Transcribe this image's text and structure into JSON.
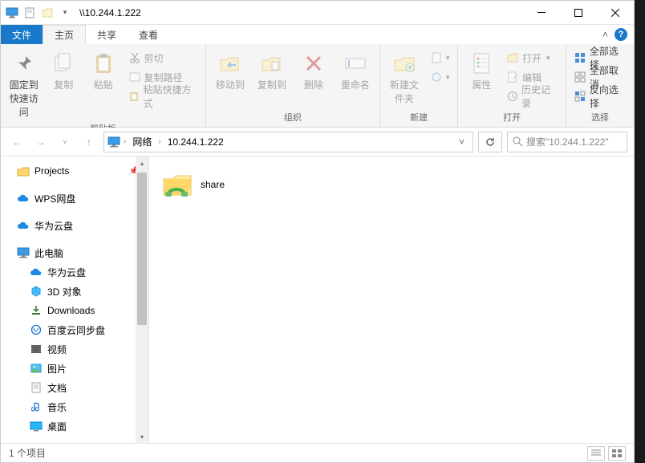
{
  "title": "\\\\10.244.1.222",
  "tabs": {
    "file": "文件",
    "home": "主页",
    "share": "共享",
    "view": "查看"
  },
  "ribbon": {
    "clipboard": {
      "label": "剪贴板",
      "pin": "固定到快速访问",
      "copy": "复制",
      "paste": "粘贴",
      "cut": "剪切",
      "copy_path": "复制路径",
      "paste_shortcut": "粘贴快捷方式"
    },
    "organize": {
      "label": "组织",
      "move_to": "移动到",
      "copy_to": "复制到",
      "delete": "删除",
      "rename": "重命名"
    },
    "new": {
      "label": "新建",
      "new_folder": "新建文件夹"
    },
    "open": {
      "label": "打开",
      "properties": "属性",
      "open": "打开",
      "edit": "编辑",
      "history": "历史记录"
    },
    "select": {
      "label": "选择",
      "select_all": "全部选择",
      "select_none": "全部取消",
      "invert": "反向选择"
    }
  },
  "breadcrumb": {
    "root": "网络",
    "host": "10.244.1.222"
  },
  "search_placeholder": "搜索\"10.244.1.222\"",
  "nav": {
    "projects": "Projects",
    "wps": "WPS网盘",
    "huawei": "华为云盘",
    "this_pc": "此电脑",
    "huawei2": "华为云盘",
    "obj3d": "3D 对象",
    "downloads": "Downloads",
    "baidu": "百度云同步盘",
    "videos": "视频",
    "pictures": "图片",
    "documents": "文档",
    "music": "音乐",
    "desktop": "桌面"
  },
  "content": {
    "share_folder": "share"
  },
  "status": {
    "items": "1 个项目"
  }
}
